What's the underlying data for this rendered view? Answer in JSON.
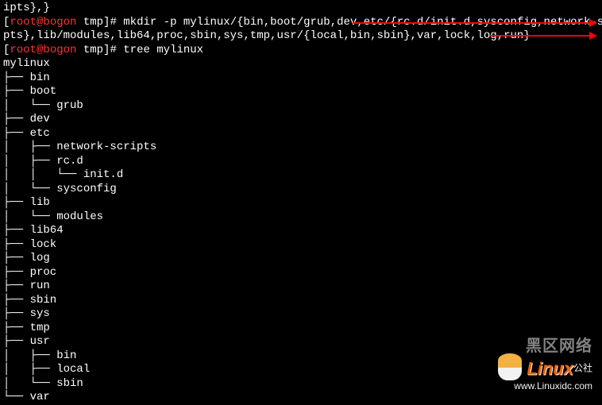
{
  "top_fragment": "ipts},}",
  "prompt1": {
    "user": "root@bogon",
    "path": "tmp",
    "command": "mkdir -p mylinux/{bin,boot/grub,dev,etc/{rc.d/init.d,sysconfig,network-scri"
  },
  "cont_line": "pts},lib/modules,lib64,proc,sbin,sys,tmp,usr/{local,bin,sbin},var,lock,log,run}",
  "prompt2": {
    "user": "root@bogon",
    "path": "tmp",
    "command": "tree mylinux"
  },
  "tree_output": [
    "mylinux",
    "├── bin",
    "├── boot",
    "│   └── grub",
    "├── dev",
    "├── etc",
    "│   ├── network-scripts",
    "│   ├── rc.d",
    "│   │   └── init.d",
    "│   └── sysconfig",
    "├── lib",
    "│   └── modules",
    "├── lib64",
    "├── lock",
    "├── log",
    "├── proc",
    "├── run",
    "├── sbin",
    "├── sys",
    "├── tmp",
    "├── usr",
    "│   ├── bin",
    "│   ├── local",
    "│   └── sbin",
    "└── var"
  ],
  "watermark": {
    "top_text": "黑区网络",
    "logo_text": "Linux",
    "sub_text": "公社",
    "url": "www.Linuxidc.com"
  }
}
